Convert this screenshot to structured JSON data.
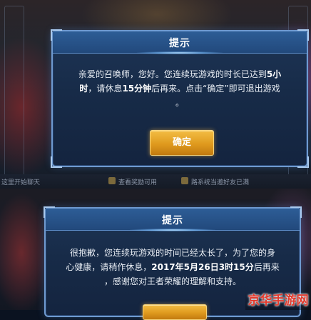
{
  "background_strip": {
    "left_text": "这里开始聊天",
    "middle_text": "查看奖励可用",
    "right_text": "路系统当邀好友已满"
  },
  "dialog_top": {
    "title": "提示",
    "line1_prefix": "亲爱的召唤师，您好。您连续玩游戏的时长已达到",
    "line1_bold": "5小",
    "line2_bold_a": "时",
    "line2_mid": "，请休息",
    "line2_bold_b": "15分钟",
    "line2_suffix": "后再来。点击“确定”即可退出游戏",
    "line3": "。",
    "confirm_label": "确定"
  },
  "dialog_bottom": {
    "title": "提示",
    "line1": "很抱歉，您连续玩游戏的时间已经太长了，为了您的身",
    "line2_prefix": "心健康，请稍作休息，",
    "line2_bold": "2017年5月26日3时15分",
    "line2_suffix": "后再来",
    "line3": "，感谢您对王者荣耀的理解和支持。"
  },
  "watermark": "京华手游网",
  "colors": {
    "dialog_border": "#6f9ad0",
    "title_bar": "#22497c",
    "button_gold": "#df9a1e",
    "watermark_red": "#e23b2e"
  }
}
